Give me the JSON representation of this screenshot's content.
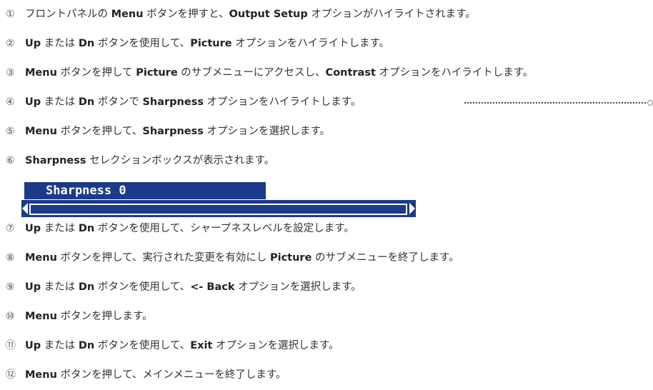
{
  "steps": [
    {
      "num": "①",
      "parts": [
        {
          "t": "フロントパネルの "
        },
        {
          "t": "Menu",
          "b": true
        },
        {
          "t": " ボタンを押すと、"
        },
        {
          "t": "Output Setup",
          "b": true
        },
        {
          "t": " オプションがハイライトされます。"
        }
      ]
    },
    {
      "num": "②",
      "parts": [
        {
          "t": "Up",
          "b": true
        },
        {
          "t": " または "
        },
        {
          "t": "Dn",
          "b": true
        },
        {
          "t": " ボタンを使用して、"
        },
        {
          "t": "Picture",
          "b": true
        },
        {
          "t": " オプションをハイライトします。"
        }
      ]
    },
    {
      "num": "③",
      "parts": [
        {
          "t": "Menu",
          "b": true
        },
        {
          "t": " ボタンを押して "
        },
        {
          "t": "Picture",
          "b": true
        },
        {
          "t": " のサブメニューにアクセスし、"
        },
        {
          "t": "Contrast",
          "b": true
        },
        {
          "t": " オプションをハイライトします。"
        }
      ]
    },
    {
      "num": "④",
      "parts": [
        {
          "t": "Up",
          "b": true
        },
        {
          "t": " または "
        },
        {
          "t": "Dn",
          "b": true
        },
        {
          "t": " ボタンで "
        },
        {
          "t": "Sharpness",
          "b": true
        },
        {
          "t": " オプションをハイライトします。"
        }
      ]
    },
    {
      "num": "⑤",
      "parts": [
        {
          "t": "Menu",
          "b": true
        },
        {
          "t": " ボタンを押して、"
        },
        {
          "t": "Sharpness",
          "b": true
        },
        {
          "t": " オプションを選択します。"
        }
      ]
    },
    {
      "num": "⑥",
      "parts": [
        {
          "t": "Sharpness",
          "b": true
        },
        {
          "t": " セレクションボックスが表示されます。"
        }
      ]
    },
    {
      "num": "⑦",
      "parts": [
        {
          "t": "Up",
          "b": true
        },
        {
          "t": " または "
        },
        {
          "t": "Dn",
          "b": true
        },
        {
          "t": " ボタンを使用して、シャープネスレベルを設定します。"
        }
      ]
    },
    {
      "num": "⑧",
      "parts": [
        {
          "t": "Menu",
          "b": true
        },
        {
          "t": " ボタンを押して、実行された変更を有効にし "
        },
        {
          "t": "Picture",
          "b": true
        },
        {
          "t": " のサブメニューを終了します。"
        }
      ]
    },
    {
      "num": "⑨",
      "parts": [
        {
          "t": "Up",
          "b": true
        },
        {
          "t": " または "
        },
        {
          "t": "Dn",
          "b": true
        },
        {
          "t": " ボタンを使用して、"
        },
        {
          "t": "<- Back",
          "b": true
        },
        {
          "t": " オプションを選択します。"
        }
      ]
    },
    {
      "num": "⑩",
      "parts": [
        {
          "t": "Menu",
          "b": true
        },
        {
          "t": " ボタンを押します。"
        }
      ]
    },
    {
      "num": "⑪",
      "parts": [
        {
          "t": "Up",
          "b": true
        },
        {
          "t": " または "
        },
        {
          "t": "Dn",
          "b": true
        },
        {
          "t": " ボタンを使用して、"
        },
        {
          "t": "Exit",
          "b": true
        },
        {
          "t": " オプションを選択します。"
        }
      ]
    },
    {
      "num": "⑫",
      "parts": [
        {
          "t": "Menu",
          "b": true
        },
        {
          "t": " ボタンを押して、メインメニューを終了します。"
        }
      ]
    }
  ],
  "osd": {
    "title": "Sharpness 0",
    "bar_color": "#1b3a8a",
    "left_icon": "triangle-left-icon",
    "right_icon": "triangle-right-icon"
  }
}
